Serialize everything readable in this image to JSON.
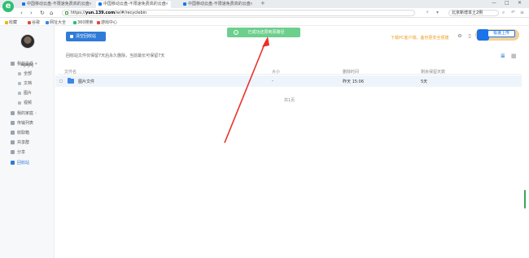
{
  "browser": {
    "tabs": [
      {
        "label": "中国移动云盘-不限速免费高的云盘",
        "active": false
      },
      {
        "label": "中国移动云盘-不限速免费高的云盘",
        "active": true
      },
      {
        "label": "中国移动云盘-不限速免费高的云盘",
        "active": false
      }
    ],
    "new_tab": "+",
    "url": {
      "prefix": "https://",
      "host": "yun.139.com",
      "path": "/w/#/recyclebin"
    },
    "search_value": "北京新增本土2例",
    "bookmarks": [
      {
        "label": "收藏",
        "color": "#f0b400"
      },
      {
        "label": "谷歌",
        "color": "#e04b3c"
      },
      {
        "label": "网址大全",
        "color": "#3b86e6"
      },
      {
        "label": "360搜索",
        "color": "#2fbf71"
      },
      {
        "label": "游戏中心",
        "color": "#e04b3c"
      }
    ]
  },
  "sidebar": {
    "username": "呵呵呵",
    "items": [
      {
        "label": "我的文件",
        "level": "top",
        "icon": "folder-icon",
        "chevron": "▾"
      },
      {
        "label": "全部",
        "level": "sub",
        "icon": "all-icon"
      },
      {
        "label": "文档",
        "level": "sub",
        "icon": "document-icon"
      },
      {
        "label": "图片",
        "level": "sub",
        "icon": "image-icon"
      },
      {
        "label": "视频",
        "level": "sub",
        "icon": "video-icon"
      },
      {
        "label": "我的家庭",
        "level": "top",
        "icon": "family-icon",
        "chevron": "›"
      },
      {
        "label": "传输列表",
        "level": "top",
        "icon": "transfer-icon"
      },
      {
        "label": "收取箱",
        "level": "top",
        "icon": "inbox-icon"
      },
      {
        "label": "共享群",
        "level": "top",
        "icon": "group-icon"
      },
      {
        "label": "分享",
        "level": "top",
        "icon": "share-icon"
      },
      {
        "label": "回收站",
        "level": "top",
        "icon": "trash-icon",
        "active": true
      }
    ]
  },
  "main": {
    "clear_button": "清空回收站",
    "toast": "已成功还原到原路径",
    "download_hint": "下载PC客户端，备份更安全便捷",
    "promo_button": "极速上传",
    "notice": "回收站文件仅保留7天后永久删除，当前最长可保留7天",
    "table": {
      "headers": [
        "文件名",
        "大小",
        "删除时间",
        "剩余保留天数"
      ],
      "rows": [
        {
          "name": "图片文件",
          "size": "-",
          "deleted": "昨天 15:06",
          "remaining": "5天"
        }
      ]
    },
    "page_info": "共1页"
  }
}
